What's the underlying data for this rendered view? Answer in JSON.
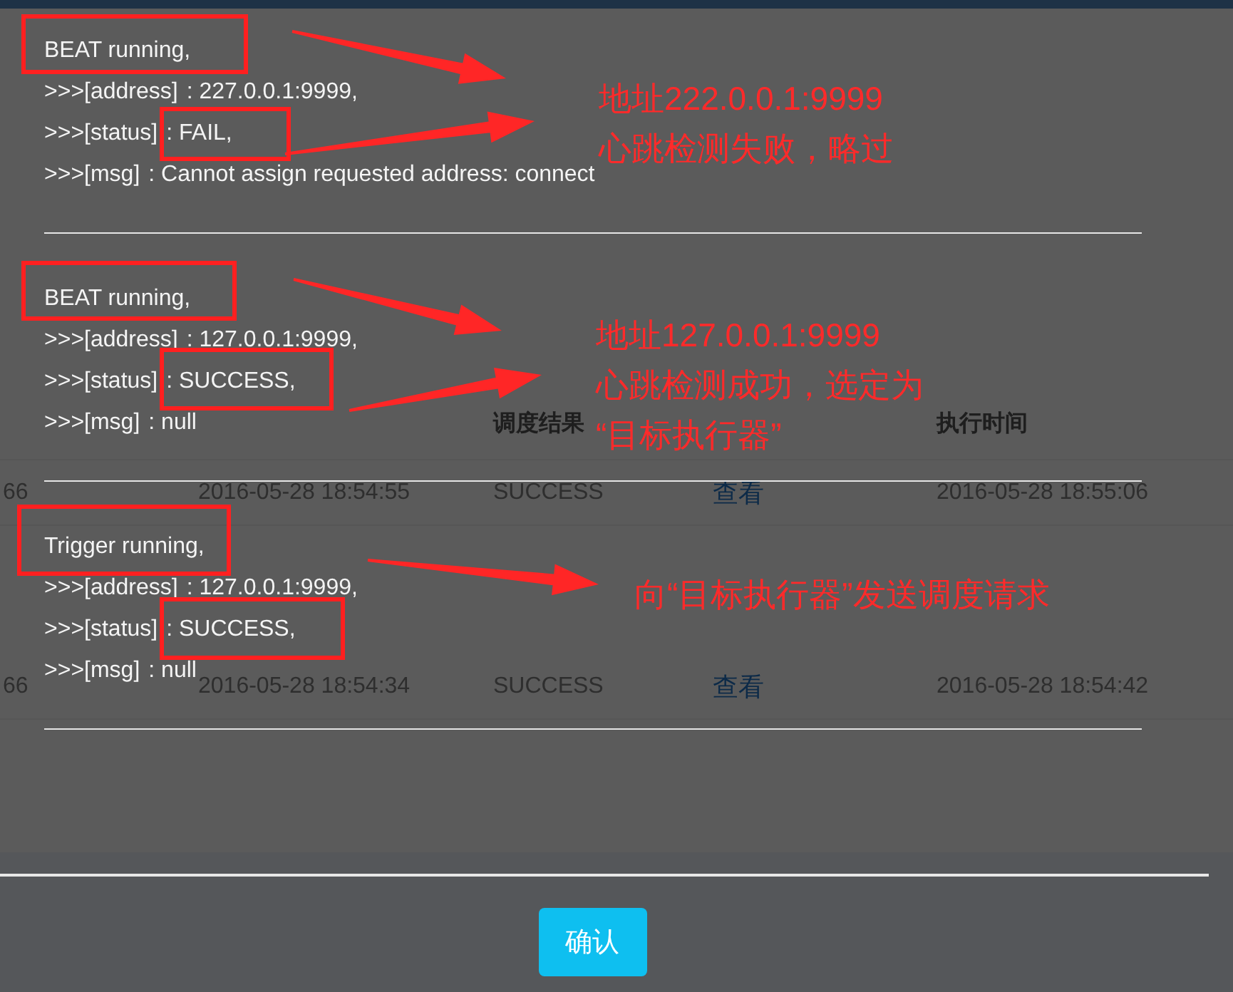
{
  "background_table": {
    "header": {
      "column_3": "调度结果",
      "column_5": "执行时间"
    },
    "rows": [
      {
        "column_1": "66",
        "column_2": "2016-05-28 18:54:55",
        "column_3": "SUCCESS",
        "column_4": "查看",
        "column_5": "2016-05-28 18:55:06"
      },
      {
        "column_1": "66",
        "column_2": "2016-05-28 18:54:34",
        "column_3": "SUCCESS",
        "column_4": "查看",
        "column_5": "2016-05-28 18:54:42"
      }
    ]
  },
  "log_blocks": [
    {
      "lines": [
        {
          "key": "BEAT running,"
        },
        {
          "key": ">>>[address]",
          "value": ": 227.0.0.1:9999,"
        },
        {
          "key": ">>>[status]",
          "value": ": FAIL,"
        },
        {
          "key": ">>>[msg]",
          "value": ": Cannot assign requested address: connect"
        }
      ]
    },
    {
      "lines": [
        {
          "key": "BEAT running,"
        },
        {
          "key": ">>>[address]",
          "value": ": 127.0.0.1:9999,"
        },
        {
          "key": ">>>[status]",
          "value": ": SUCCESS,"
        },
        {
          "key": ">>>[msg]",
          "value": ": null"
        }
      ]
    },
    {
      "lines": [
        {
          "key": "Trigger running,"
        },
        {
          "key": ">>>[address]",
          "value": ": 127.0.0.1:9999,"
        },
        {
          "key": ">>>[status]",
          "value": ": SUCCESS,"
        },
        {
          "key": ">>>[msg]",
          "value": ": null"
        }
      ]
    }
  ],
  "annotations": [
    {
      "lines": [
        "地址222.0.0.1:9999",
        "心跳检测失败，略过"
      ]
    },
    {
      "lines": [
        "地址127.0.0.1:9999",
        "心跳检测成功，选定为",
        "“目标执行器”"
      ]
    },
    {
      "lines": [
        "向“目标执行器”发送调度请求"
      ]
    }
  ],
  "confirm_button": "确认"
}
